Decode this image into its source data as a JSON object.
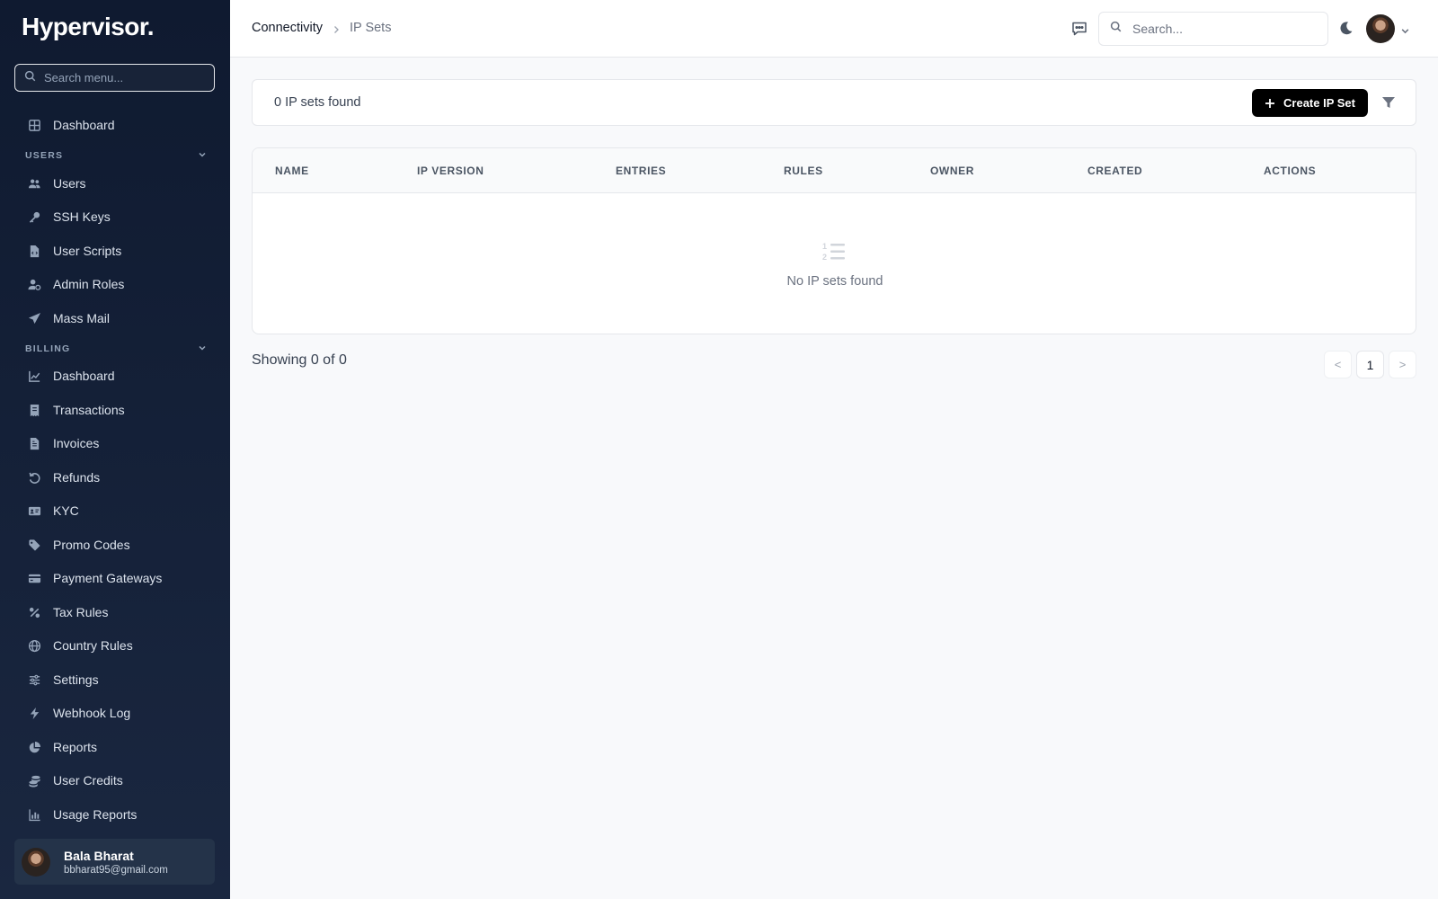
{
  "sidebar": {
    "brand": "Hypervisor.",
    "search_placeholder": "Search menu...",
    "top_items": [
      {
        "label": "Dashboard",
        "icon": "grid-icon"
      }
    ],
    "sections": [
      {
        "label": "USERS",
        "items": [
          {
            "label": "Users",
            "icon": "users-icon"
          },
          {
            "label": "SSH Keys",
            "icon": "key-icon"
          },
          {
            "label": "User Scripts",
            "icon": "file-code-icon"
          },
          {
            "label": "Admin Roles",
            "icon": "user-gear-icon"
          },
          {
            "label": "Mass Mail",
            "icon": "paper-plane-icon"
          }
        ]
      },
      {
        "label": "BILLING",
        "items": [
          {
            "label": "Dashboard",
            "icon": "line-chart-icon"
          },
          {
            "label": "Transactions",
            "icon": "receipt-icon"
          },
          {
            "label": "Invoices",
            "icon": "invoice-icon"
          },
          {
            "label": "Refunds",
            "icon": "undo-icon"
          },
          {
            "label": "KYC",
            "icon": "id-card-icon"
          },
          {
            "label": "Promo Codes",
            "icon": "tag-icon"
          },
          {
            "label": "Payment Gateways",
            "icon": "credit-card-icon"
          },
          {
            "label": "Tax Rules",
            "icon": "percent-icon"
          },
          {
            "label": "Country Rules",
            "icon": "globe-icon"
          },
          {
            "label": "Settings",
            "icon": "sliders-icon"
          },
          {
            "label": "Webhook Log",
            "icon": "bolt-icon"
          },
          {
            "label": "Reports",
            "icon": "pie-chart-icon"
          },
          {
            "label": "User Credits",
            "icon": "coins-icon"
          },
          {
            "label": "Usage Reports",
            "icon": "bar-chart-icon"
          }
        ]
      }
    ],
    "user": {
      "name": "Bala Bharat",
      "email": "bbharat95@gmail.com"
    }
  },
  "header": {
    "breadcrumb_root": "Connectivity",
    "breadcrumb_current": "IP Sets",
    "search_placeholder": "Search..."
  },
  "toolbar": {
    "count_text": "0 IP sets found",
    "create_label": "Create IP Set"
  },
  "table": {
    "columns": [
      "NAME",
      "IP VERSION",
      "ENTRIES",
      "RULES",
      "OWNER",
      "CREATED",
      "ACTIONS"
    ],
    "rows": [],
    "empty_text": "No IP sets found"
  },
  "pagination": {
    "showing_text": "Showing 0 of 0",
    "prev_label": "<",
    "current_page": "1",
    "next_label": ">"
  },
  "colors": {
    "sidebar_bg": "#0f1a30",
    "primary_button": "#000000",
    "page_bg": "#f8f9fb"
  }
}
